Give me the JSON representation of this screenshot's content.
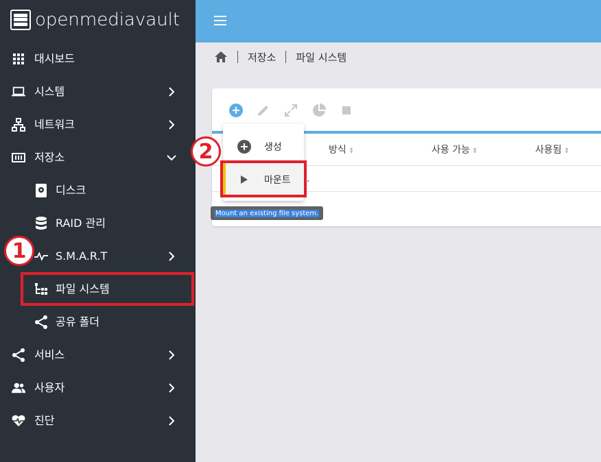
{
  "app": {
    "title": "openmediavault"
  },
  "sidebar": {
    "items": [
      {
        "label": "대시보드",
        "icon": "dashboard-icon"
      },
      {
        "label": "시스템",
        "icon": "laptop-icon"
      },
      {
        "label": "네트워크",
        "icon": "network-icon"
      },
      {
        "label": "저장소",
        "icon": "storage-icon"
      },
      {
        "label": "디스크",
        "icon": "disk-icon"
      },
      {
        "label": "RAID 관리",
        "icon": "database-icon"
      },
      {
        "label": "S.M.A.R.T",
        "icon": "pulse-icon"
      },
      {
        "label": "파일 시스템",
        "icon": "filesystem-tree-icon"
      },
      {
        "label": "공유 폴더",
        "icon": "share-icon"
      },
      {
        "label": "서비스",
        "icon": "share-icon"
      },
      {
        "label": "사용자",
        "icon": "users-icon"
      },
      {
        "label": "진단",
        "icon": "heart-pulse-icon"
      }
    ]
  },
  "breadcrumb": {
    "items": [
      "저장소",
      "파일 시스템"
    ]
  },
  "table": {
    "columns": [
      "방식",
      "사용 가능",
      "사용됨"
    ],
    "row_text": "."
  },
  "menu": {
    "items": [
      {
        "label": "생성",
        "icon": "plus-circle-icon"
      },
      {
        "label": "마운트",
        "icon": "play-icon"
      }
    ]
  },
  "tooltip": {
    "text": "Mount an existing file system."
  },
  "annotations": {
    "badge1": "1",
    "badge2": "2"
  },
  "colors": {
    "sidebar": "#2a3139",
    "topbar": "#5dade2",
    "highlight": "#e0202c",
    "active_bar": "#f1c40f"
  }
}
